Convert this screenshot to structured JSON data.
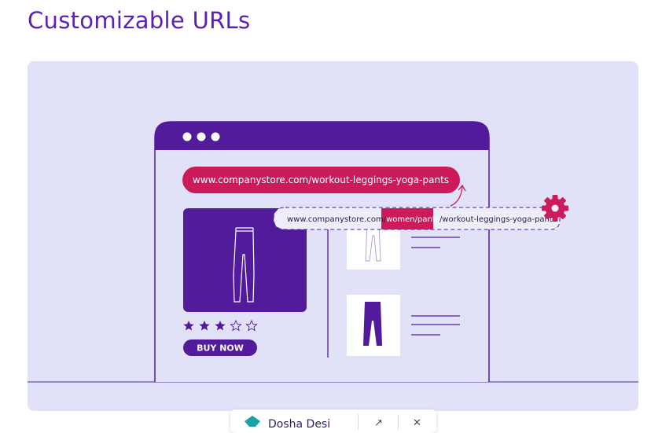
{
  "page": {
    "title": "Customizable URLs"
  },
  "illustration": {
    "original_url": "www.companystore.com/workout-leggings-yoga-pants",
    "custom_url": {
      "prefix": "www.companystore.com/",
      "highlight": "women/pants",
      "suffix": "/workout-leggings-yoga-pants"
    },
    "buy_button_label": "BUY NOW",
    "rating": {
      "value": 3,
      "max": 5
    },
    "colors": {
      "accent_purple": "#521b9c",
      "accent_pink": "#cc1a5b",
      "panel_bg": "#e1e1f7"
    },
    "icons": [
      "gear-icon",
      "star-icon",
      "curved-arrow-icon"
    ]
  },
  "toolbar": {
    "brand": "Dosha Desi",
    "icons": [
      "app-logo-icon",
      "share-arrow-icon",
      "close-icon"
    ]
  }
}
